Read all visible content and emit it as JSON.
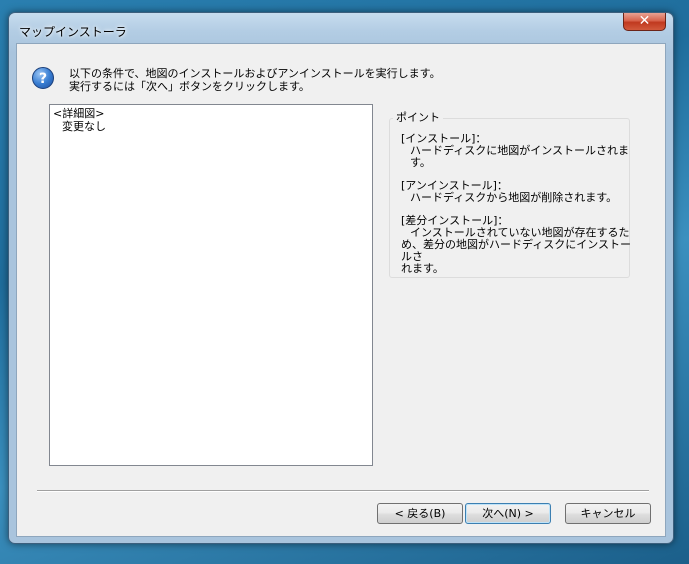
{
  "window": {
    "title": "マップインストーラ",
    "close_glyph": "✕"
  },
  "header": {
    "icon": "question-icon",
    "line1": "以下の条件で、地図のインストールおよびアンインストールを実行します。",
    "line2": "実行するには「次へ」ボタンをクリックします。"
  },
  "summary": {
    "heading": "<詳細図>",
    "value": "変更なし"
  },
  "hints": {
    "legend": "ポイント",
    "items": [
      {
        "title": "[インストール]：",
        "desc": "ハードディスクに地図がインストールされます。"
      },
      {
        "title": "[アンインストール]：",
        "desc": "ハードディスクから地図が削除されます。"
      },
      {
        "title": "[差分インストール]：",
        "desc_line1": "インストールされていない地図が存在するた",
        "desc_line2": "め、差分の地図がハードディスクにインストールさ",
        "desc_line3": "れます。"
      }
    ]
  },
  "buttons": {
    "back": "< 戻る(B)",
    "next": "次へ(N) >",
    "cancel": "キャンセル"
  }
}
